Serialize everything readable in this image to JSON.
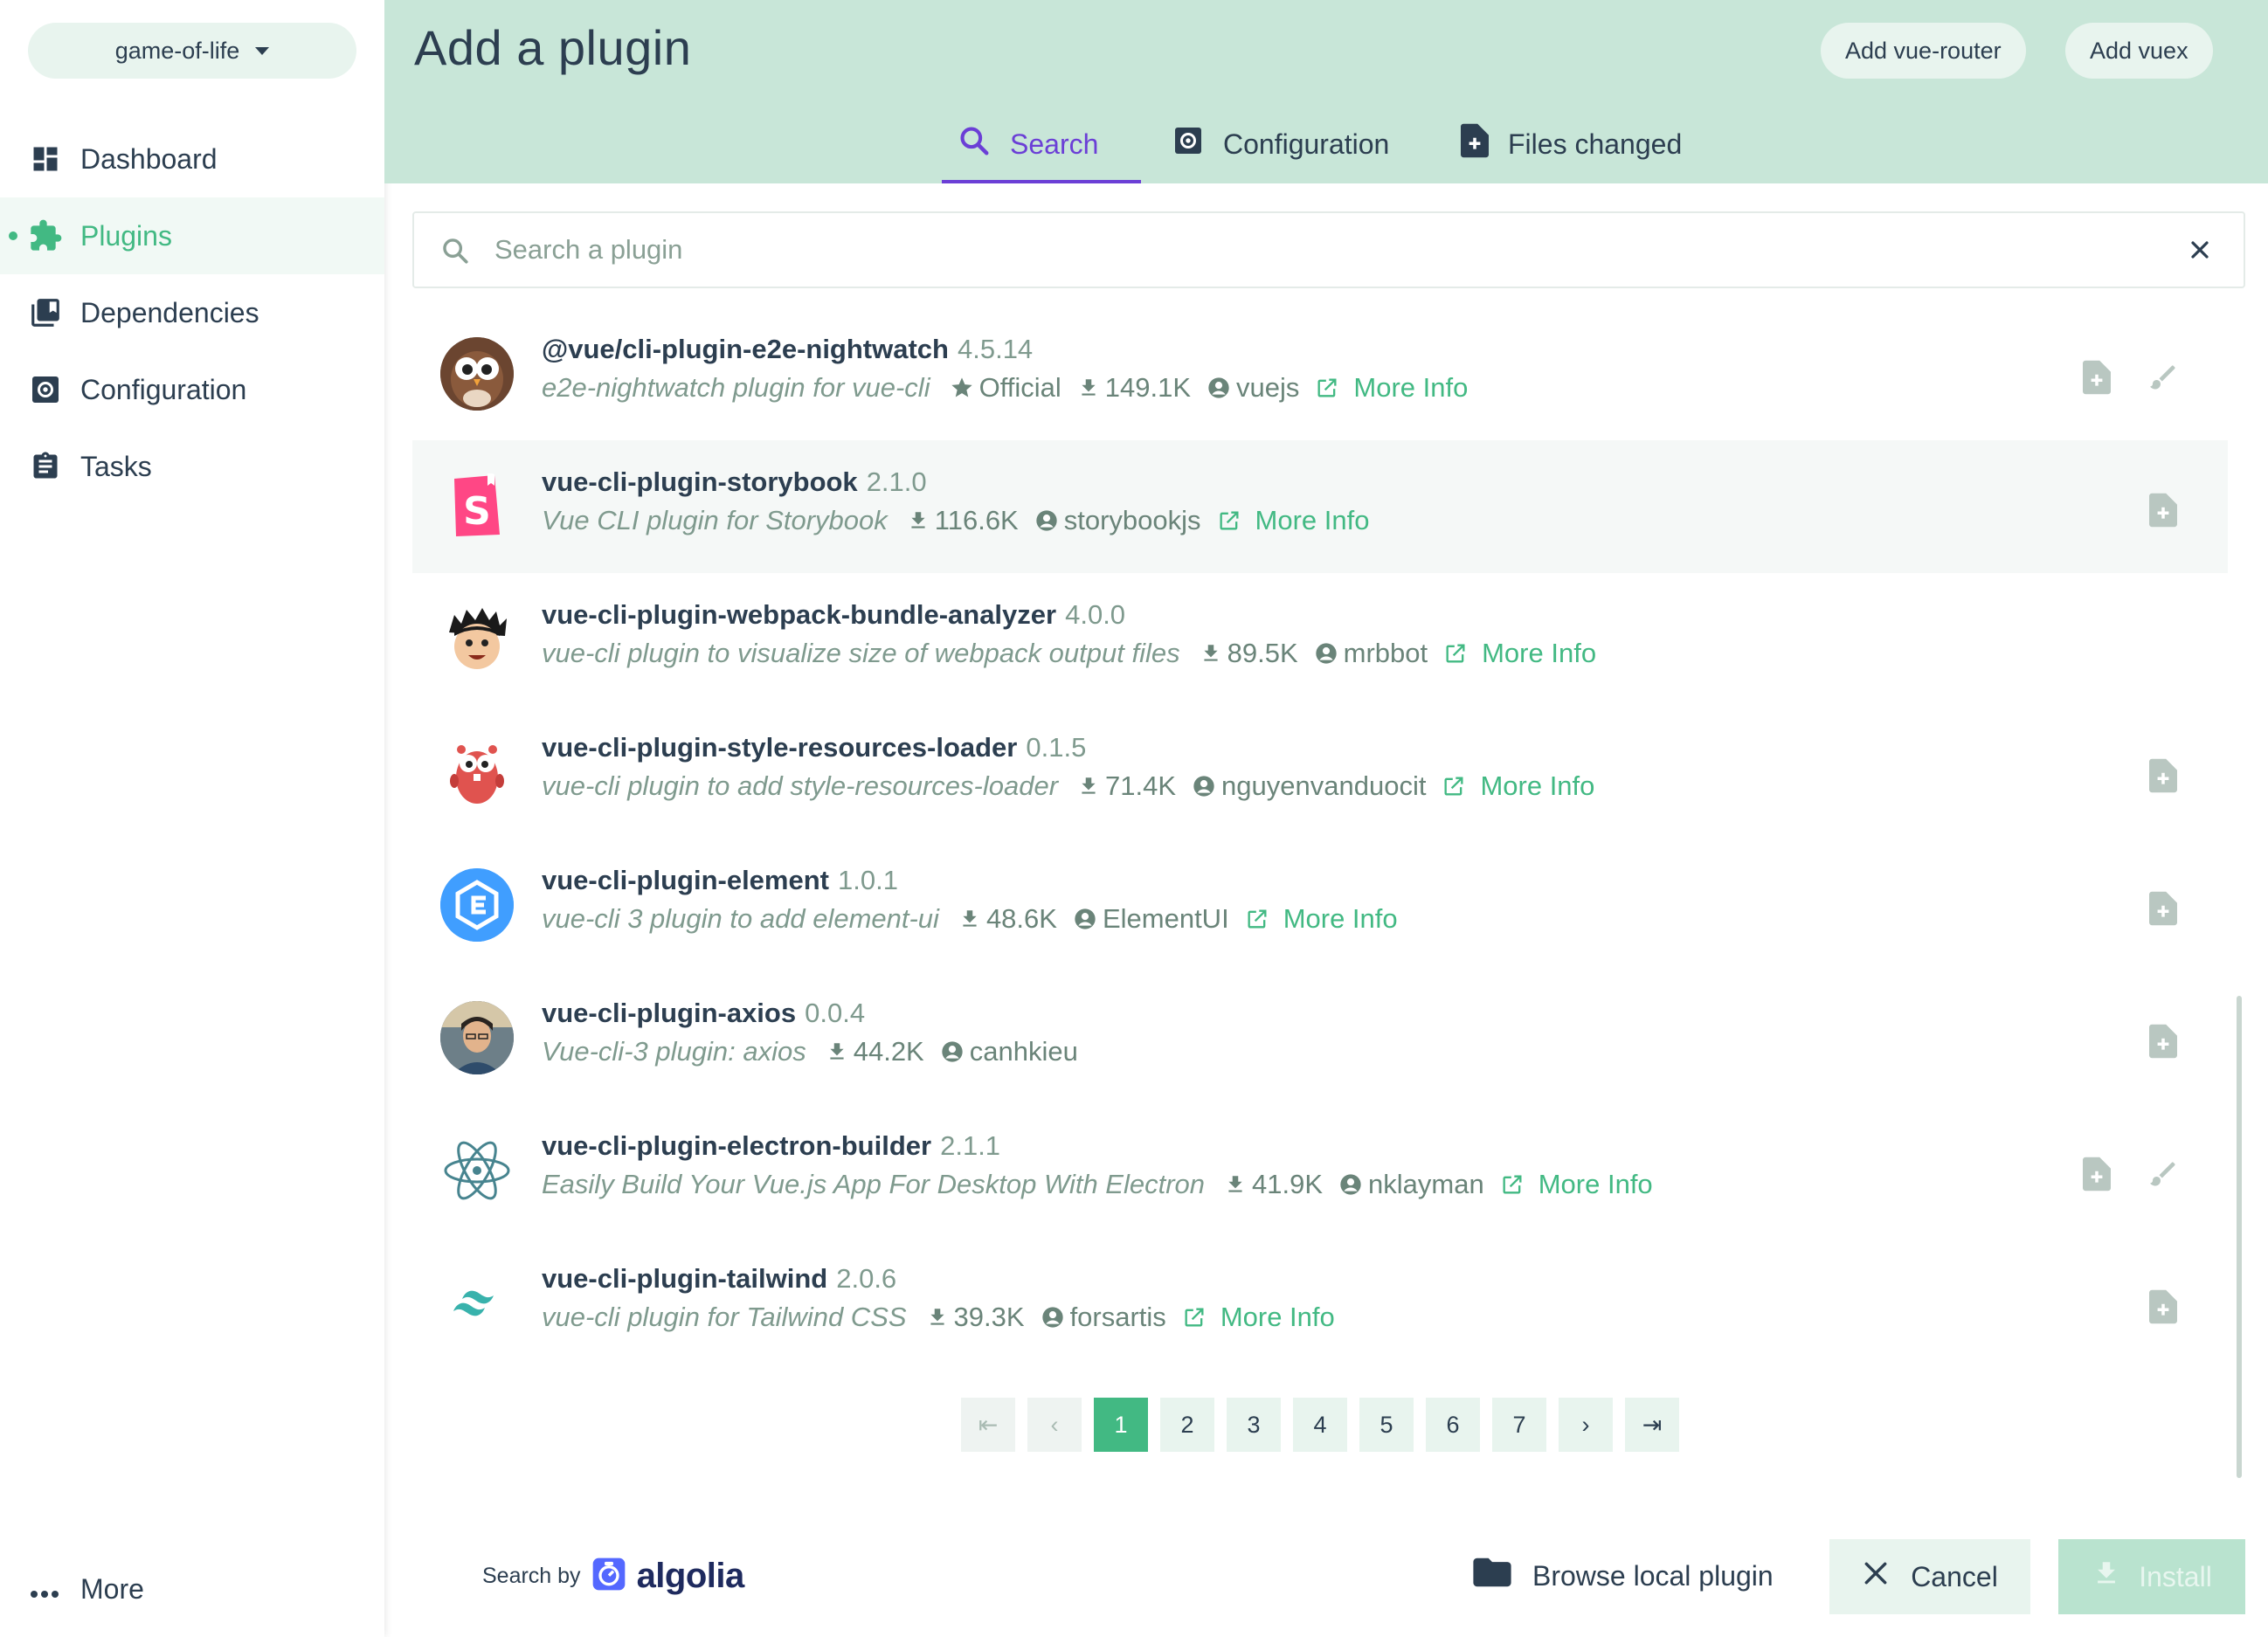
{
  "sidebar": {
    "project": "game-of-life",
    "items": [
      {
        "label": "Dashboard",
        "icon": "dashboard-icon"
      },
      {
        "label": "Plugins",
        "icon": "puzzle-icon",
        "active": true
      },
      {
        "label": "Dependencies",
        "icon": "library-icon"
      },
      {
        "label": "Configuration",
        "icon": "gear-icon"
      },
      {
        "label": "Tasks",
        "icon": "clipboard-icon"
      }
    ],
    "more": "More"
  },
  "header": {
    "title": "Add a plugin",
    "buttons": [
      "Add vue-router",
      "Add vuex"
    ],
    "tabs": [
      {
        "label": "Search",
        "icon": "search-icon",
        "active": true
      },
      {
        "label": "Configuration",
        "icon": "gear-icon"
      },
      {
        "label": "Files changed",
        "icon": "file-plus-icon"
      }
    ]
  },
  "search": {
    "placeholder": "Search a plugin",
    "value": ""
  },
  "plugins": [
    {
      "name": "@vue/cli-plugin-e2e-nightwatch",
      "version": "4.5.14",
      "description": "e2e-nightwatch plugin for vue-cli",
      "official": "Official",
      "downloads": "149.1K",
      "author": "vuejs",
      "more_info": "More Info",
      "logo": "owl-logo"
    },
    {
      "name": "vue-cli-plugin-storybook",
      "version": "2.1.0",
      "description": "Vue CLI plugin for Storybook",
      "downloads": "116.6K",
      "author": "storybookjs",
      "more_info": "More Info",
      "logo": "storybook-logo"
    },
    {
      "name": "vue-cli-plugin-webpack-bundle-analyzer",
      "version": "4.0.0",
      "description": "vue-cli plugin to visualize size of webpack output files",
      "downloads": "89.5K",
      "author": "mrbbot",
      "more_info": "More Info",
      "logo": "cartoon-face-logo"
    },
    {
      "name": "vue-cli-plugin-style-resources-loader",
      "version": "0.1.5",
      "description": "vue-cli plugin to add style-resources-loader",
      "downloads": "71.4K",
      "author": "nguyenvanduocit",
      "more_info": "More Info",
      "logo": "gopher-logo"
    },
    {
      "name": "vue-cli-plugin-element",
      "version": "1.0.1",
      "description": "vue-cli 3 plugin to add element-ui",
      "downloads": "48.6K",
      "author": "ElementUI",
      "more_info": "More Info",
      "logo": "element-logo"
    },
    {
      "name": "vue-cli-plugin-axios",
      "version": "0.0.4",
      "description": "Vue-cli-3 plugin: axios",
      "downloads": "44.2K",
      "author": "canhkieu",
      "more_info": "",
      "logo": "avatar-photo"
    },
    {
      "name": "vue-cli-plugin-electron-builder",
      "version": "2.1.1",
      "description": "Easily Build Your Vue.js App For Desktop With Electron",
      "downloads": "41.9K",
      "author": "nklayman",
      "more_info": "More Info",
      "logo": "electron-logo"
    },
    {
      "name": "vue-cli-plugin-tailwind",
      "version": "2.0.6",
      "description": "vue-cli plugin for Tailwind CSS",
      "downloads": "39.3K",
      "author": "forsartis",
      "more_info": "More Info",
      "logo": "tailwind-logo"
    }
  ],
  "pagination": {
    "first": "⇤",
    "prev": "‹",
    "pages": [
      "1",
      "2",
      "3",
      "4",
      "5",
      "6",
      "7"
    ],
    "current": "1",
    "next": "›",
    "last": "⇥"
  },
  "footer": {
    "search_by": "Search by",
    "algolia": "algolia",
    "browse": "Browse local plugin",
    "cancel": "Cancel",
    "install": "Install"
  },
  "colors": {
    "accent": "#42b983",
    "header": "#c8e6d8",
    "tab_active": "#6b3fd6",
    "text": "#2c3e50"
  }
}
